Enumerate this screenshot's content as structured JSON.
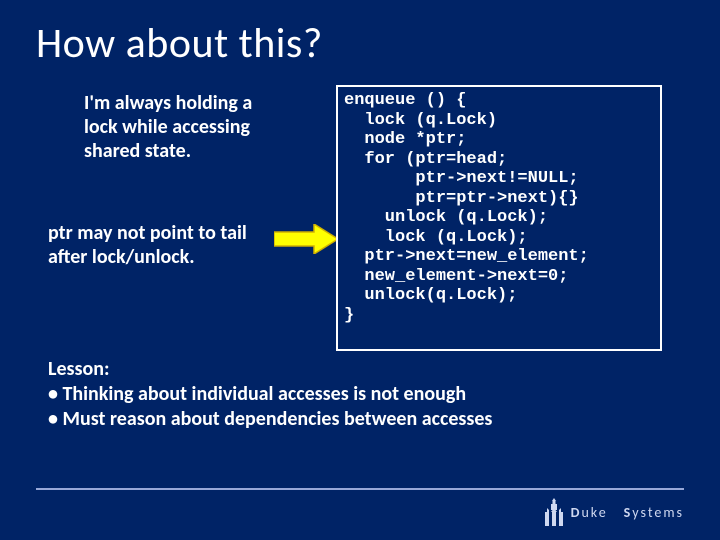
{
  "title": "How about this?",
  "commentary1": "I'm always holding a lock while accessing shared state.",
  "commentary2": "ptr may not point to tail after lock/unlock.",
  "code": "enqueue () {\n  lock (q.Lock)\n  node *ptr;\n  for (ptr=head;\n       ptr->next!=NULL;\n       ptr=ptr->next){}\n    unlock (q.Lock);\n    lock (q.Lock);\n  ptr->next=new_element;\n  new_element->next=0;\n  unlock(q.Lock);\n}",
  "lesson": {
    "heading": "Lesson:",
    "bullets": [
      "• Thinking about individual accesses is not enough",
      "• Must reason about dependencies between accesses"
    ]
  },
  "footer": {
    "brand_prefix": "D",
    "brand_rest": "uke ",
    "brand_prefix2": "S",
    "brand_rest2": "ystems"
  },
  "colors": {
    "bg": "#002366",
    "text": "#ffffff",
    "arrow_fill": "#ffff00",
    "arrow_stroke": "#d0b000"
  }
}
